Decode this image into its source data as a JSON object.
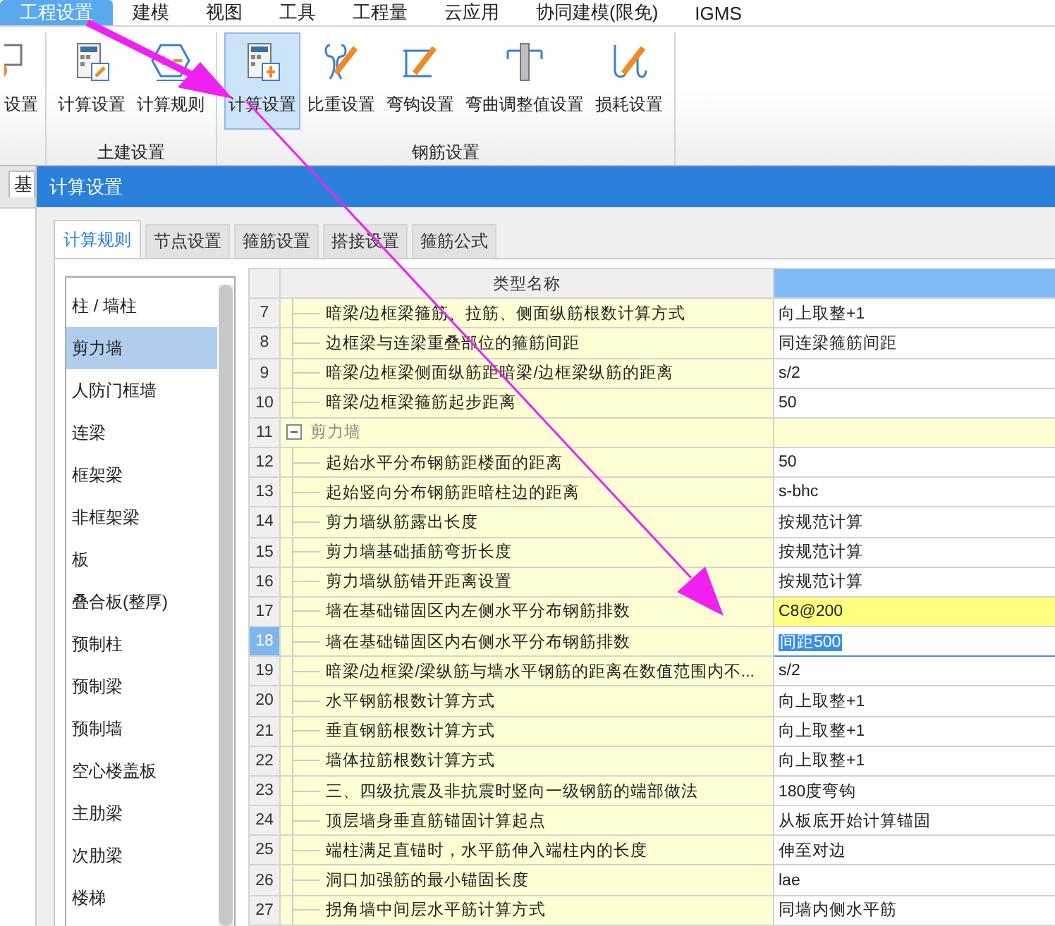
{
  "menu": [
    {
      "label": "工程设置",
      "selected": true
    },
    {
      "label": "建模",
      "selected": false
    },
    {
      "label": "视图",
      "selected": false
    },
    {
      "label": "工具",
      "selected": false
    },
    {
      "label": "工程量",
      "selected": false
    },
    {
      "label": "云应用",
      "selected": false
    },
    {
      "label": "协同建模(限免)",
      "selected": false
    },
    {
      "label": "IGMS",
      "selected": false
    }
  ],
  "ribbon": {
    "groups": [
      {
        "buttons": [
          {
            "label": "设置",
            "selected": false
          }
        ]
      },
      {
        "label": "土建设置",
        "buttons": [
          {
            "label": "计算设置",
            "selected": false
          },
          {
            "label": "计算规则",
            "selected": false
          }
        ]
      },
      {
        "label": "钢筋设置",
        "buttons": [
          {
            "label": "计算设置",
            "selected": true
          },
          {
            "label": "比重设置",
            "selected": false
          },
          {
            "label": "弯钩设置",
            "selected": false
          },
          {
            "label": "弯曲调整值设置",
            "selected": false
          },
          {
            "label": "损耗设置",
            "selected": false
          }
        ]
      }
    ]
  },
  "back_tab": {
    "label": "基"
  },
  "dialog": {
    "title": "计算设置",
    "tabs": [
      {
        "label": "计算规则",
        "selected": true
      },
      {
        "label": "节点设置",
        "selected": false
      },
      {
        "label": "箍筋设置",
        "selected": false
      },
      {
        "label": "搭接设置",
        "selected": false
      },
      {
        "label": "箍筋公式",
        "selected": false
      }
    ],
    "categories": [
      {
        "label": "柱 / 墙柱",
        "selected": false
      },
      {
        "label": "剪力墙",
        "selected": true
      },
      {
        "label": "人防门框墙",
        "selected": false
      },
      {
        "label": "连梁",
        "selected": false
      },
      {
        "label": "框架梁",
        "selected": false
      },
      {
        "label": "非框架梁",
        "selected": false
      },
      {
        "label": "板",
        "selected": false
      },
      {
        "label": "叠合板(整厚)",
        "selected": false
      },
      {
        "label": "预制柱",
        "selected": false
      },
      {
        "label": "预制梁",
        "selected": false
      },
      {
        "label": "预制墙",
        "selected": false
      },
      {
        "label": "空心楼盖板",
        "selected": false
      },
      {
        "label": "主肋梁",
        "selected": false
      },
      {
        "label": "次肋梁",
        "selected": false
      },
      {
        "label": "楼梯",
        "selected": false
      }
    ],
    "table": {
      "header": "类型名称",
      "rows": [
        {
          "number": "7",
          "kind": "item",
          "name": "暗梁/边框梁箍筋、拉筋、侧面纵筋根数计算方式",
          "value": "向上取整+1",
          "selected": false,
          "highlighted": false
        },
        {
          "number": "8",
          "kind": "item",
          "name": "边框梁与连梁重叠部位的箍筋间距",
          "value": "同连梁箍筋间距",
          "selected": false,
          "highlighted": false
        },
        {
          "number": "9",
          "kind": "item",
          "name": "暗梁/边框梁侧面纵筋距暗梁/边框梁纵筋的距离",
          "value": "s/2",
          "selected": false,
          "highlighted": false
        },
        {
          "number": "10",
          "kind": "item",
          "name": "暗梁/边框梁箍筋起步距离",
          "value": "50",
          "selected": false,
          "highlighted": false
        },
        {
          "number": "11",
          "kind": "group",
          "name": "剪力墙",
          "expanded": true,
          "selected": false
        },
        {
          "number": "12",
          "kind": "item",
          "name": "起始水平分布钢筋距楼面的距离",
          "value": "50",
          "selected": false,
          "highlighted": false
        },
        {
          "number": "13",
          "kind": "item",
          "name": "起始竖向分布钢筋距暗柱边的距离",
          "value": "s-bhc",
          "selected": false,
          "highlighted": false
        },
        {
          "number": "14",
          "kind": "item",
          "name": "剪力墙纵筋露出长度",
          "value": "按规范计算",
          "selected": false,
          "highlighted": false
        },
        {
          "number": "15",
          "kind": "item",
          "name": "剪力墙基础插筋弯折长度",
          "value": "按规范计算",
          "selected": false,
          "highlighted": false
        },
        {
          "number": "16",
          "kind": "item",
          "name": "剪力墙纵筋错开距离设置",
          "value": "按规范计算",
          "selected": false,
          "highlighted": false
        },
        {
          "number": "17",
          "kind": "item",
          "name": "墙在基础锚固区内左侧水平分布钢筋排数",
          "value": "C8@200",
          "selected": false,
          "highlighted": true
        },
        {
          "number": "18",
          "kind": "item",
          "name": "墙在基础锚固区内右侧水平分布钢筋排数",
          "value": "间距500",
          "selected": true,
          "highlighted": false
        },
        {
          "number": "19",
          "kind": "item",
          "name": "暗梁/边框梁/梁纵筋与墙水平钢筋的距离在数值范围内不...",
          "value": "s/2",
          "selected": false,
          "highlighted": false
        },
        {
          "number": "20",
          "kind": "item",
          "name": "水平钢筋根数计算方式",
          "value": "向上取整+1",
          "selected": false,
          "highlighted": false
        },
        {
          "number": "21",
          "kind": "item",
          "name": "垂直钢筋根数计算方式",
          "value": "向上取整+1",
          "selected": false,
          "highlighted": false
        },
        {
          "number": "22",
          "kind": "item",
          "name": "墙体拉筋根数计算方式",
          "value": "向上取整+1",
          "selected": false,
          "highlighted": false
        },
        {
          "number": "23",
          "kind": "item",
          "name": "三、四级抗震及非抗震时竖向一级钢筋的端部做法",
          "value": "180度弯钩",
          "selected": false,
          "highlighted": false
        },
        {
          "number": "24",
          "kind": "item",
          "name": "顶层墙身垂直筋锚固计算起点",
          "value": "从板底开始计算锚固",
          "selected": false,
          "highlighted": false
        },
        {
          "number": "25",
          "kind": "item",
          "name": "端柱满足直锚时，水平筋伸入端柱内的长度",
          "value": "伸至对边",
          "selected": false,
          "highlighted": false
        },
        {
          "number": "26",
          "kind": "item",
          "name": "洞口加强筋的最小锚固长度",
          "value": "lae",
          "selected": false,
          "highlighted": false
        },
        {
          "number": "27",
          "kind": "item",
          "name": "拐角墙中间层水平筋计算方式",
          "value": "同墙内侧水平筋",
          "selected": false,
          "highlighted": false
        }
      ]
    }
  }
}
